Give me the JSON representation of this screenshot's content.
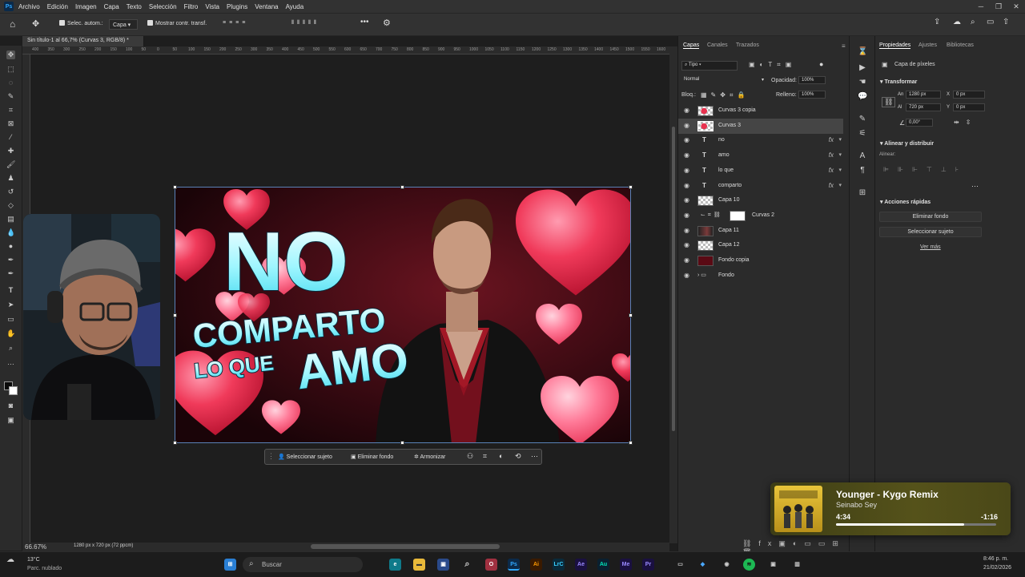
{
  "app": {
    "logo": "Ps"
  },
  "menu": [
    "Archivo",
    "Edición",
    "Imagen",
    "Capa",
    "Texto",
    "Selección",
    "Filtro",
    "Vista",
    "Plugins",
    "Ventana",
    "Ayuda"
  ],
  "options": {
    "auto_select": "Selec. autom.:",
    "layer_select": "Capa",
    "show_transform": "Mostrar contr. transf."
  },
  "doc_tab": "Sin título-1 al 66,7% (Curvas 3, RGB/8) *",
  "ruler_ticks": [
    "400",
    "350",
    "300",
    "250",
    "200",
    "150",
    "100",
    "50",
    "0",
    "50",
    "100",
    "150",
    "200",
    "250",
    "300",
    "350",
    "400",
    "450",
    "500",
    "550",
    "600",
    "650",
    "700",
    "750",
    "800",
    "850",
    "900",
    "950",
    "1000",
    "1050",
    "1100",
    "1150",
    "1200",
    "1250",
    "1300",
    "1350",
    "1400",
    "1450",
    "1500",
    "1550",
    "1600"
  ],
  "canvas": {
    "line1": "NO",
    "line2": "COMPARTO",
    "line3a": "LO QUE",
    "line3b": "AMO"
  },
  "context_bar": {
    "select_subject": "Seleccionar sujeto",
    "remove_bg": "Eliminar fondo",
    "harmonize": "Armonizar"
  },
  "status": {
    "zoom": "66.67%",
    "size": "1280 px x 720 px (72 ppcm)"
  },
  "layers_panel": {
    "tabs": [
      "Capas",
      "Canales",
      "Trazados"
    ],
    "filter": "Tipo",
    "blend": "Normal",
    "opacity_label": "Opacidad:",
    "opacity": "100%",
    "lock_label": "Bloq.:",
    "fill_label": "Relleno:",
    "fill": "100%",
    "layers": [
      {
        "name": "Curvas 3 copia",
        "type": "pixel"
      },
      {
        "name": "Curvas 3",
        "type": "pixel",
        "active": true
      },
      {
        "name": "no",
        "type": "text",
        "fx": "fx"
      },
      {
        "name": "amo",
        "type": "text",
        "fx": "fx"
      },
      {
        "name": "lo que",
        "type": "text",
        "fx": "fx"
      },
      {
        "name": "comparto",
        "type": "text",
        "fx": "fx"
      },
      {
        "name": "Capa 10",
        "type": "pixel"
      },
      {
        "name": "Curvas 2",
        "type": "adjust"
      },
      {
        "name": "Capa 11",
        "type": "photo"
      },
      {
        "name": "Capa 12",
        "type": "pixel"
      },
      {
        "name": "Fondo copia",
        "type": "dark"
      },
      {
        "name": "Fondo",
        "type": "group"
      }
    ]
  },
  "properties": {
    "tabs": [
      "Propiedades",
      "Ajustes",
      "Bibliotecas"
    ],
    "kind": "Capa de píxeles",
    "transform_title": "Transformar",
    "w_label": "An",
    "w": "1280 px",
    "h_label": "Al",
    "h": "720 px",
    "x_label": "X",
    "x": "0 px",
    "y_label": "Y",
    "y": "0 px",
    "angle": "0,00°",
    "align_title": "Alinear y distribuir",
    "align_label": "Alinear:",
    "quick_title": "Acciones rápidas",
    "btn_remove": "Eliminar fondo",
    "btn_select": "Seleccionar sujeto",
    "see_more": "Ver más"
  },
  "music": {
    "title": "Younger - Kygo Remix",
    "artist": "Seinabo Sey",
    "elapsed": "4:34",
    "remaining": "-1:16",
    "progress": 0.8
  },
  "taskbar": {
    "weather_temp": "13°C",
    "weather_desc": "Parc. nublado",
    "search": "Buscar",
    "time": "8:46 p. m.",
    "date": "21/02/2026"
  },
  "colors": {
    "accent": "#31a8ff",
    "heart": "#e8324f",
    "text_cyan": "#7ff0ff"
  }
}
